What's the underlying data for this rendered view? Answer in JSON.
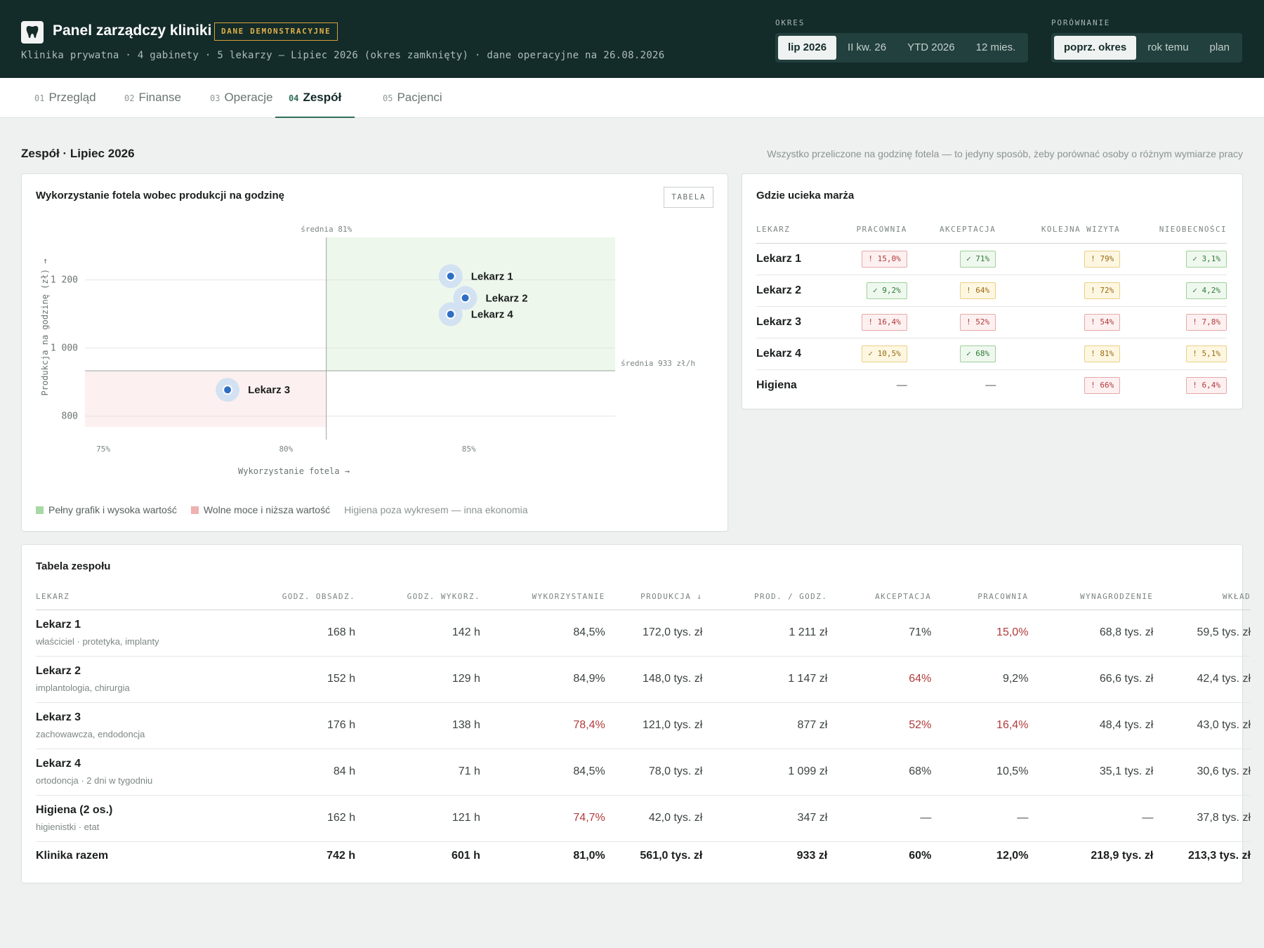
{
  "header": {
    "title": "Panel zarządczy kliniki",
    "badge": "DANE DEMONSTRACYJNE",
    "subtitle": "Klinika prywatna · 4 gabinety · 5 lekarzy — Lipiec 2026 (okres zamknięty) · dane operacyjne na 26.08.2026",
    "period_label": "OKRES",
    "period_options": [
      "lip 2026",
      "II kw. 26",
      "YTD 2026",
      "12 mies."
    ],
    "period_selected": "lip 2026",
    "compare_label": "PORÓWNANIE",
    "compare_options": [
      "poprz. okres",
      "rok temu",
      "plan"
    ],
    "compare_selected": "poprz. okres"
  },
  "tabs": [
    {
      "num": "01",
      "label": "Przegląd"
    },
    {
      "num": "02",
      "label": "Finanse"
    },
    {
      "num": "03",
      "label": "Operacje"
    },
    {
      "num": "04",
      "label": "Zespół",
      "active": true
    },
    {
      "num": "05",
      "label": "Pacjenci"
    }
  ],
  "section": {
    "title": "Zespół · Lipiec 2026",
    "note": "Wszystko przeliczone na godzinę fotela — to jedyny sposób, żeby porównać osoby o różnym wymiarze pracy"
  },
  "scatter": {
    "title": "Wykorzystanie fotela wobec produkcji na godzinę",
    "table_button": "TABELA",
    "avg_x_label": "średnia 81%",
    "avg_y_label": "średnia 933 zł/h",
    "legend_good": "Pełny grafik i wysoka wartość",
    "legend_bad": "Wolne moce i niższa wartość",
    "legend_note": "Higiena poza wykresem — inna ekonomia",
    "colors": {
      "good_zone": "#eef7ec",
      "bad_zone": "#fdf0f0",
      "point": "#2e6fc4",
      "halo": "#d3e2f2"
    }
  },
  "chart_data": {
    "type": "scatter",
    "xlabel": "Wykorzystanie fotela →",
    "ylabel": "Produkcja na godzinę (zł) →",
    "x_ticks": [
      "75%",
      "80%",
      "85%"
    ],
    "y_ticks": [
      "1 200",
      "1 000",
      "800"
    ],
    "xlim": [
      74.5,
      89
    ],
    "ylim": [
      768,
      1325
    ],
    "avg_x": 81.1,
    "avg_y": 933,
    "points": [
      {
        "label": "Lekarz 1",
        "x": 84.5,
        "y": 1211
      },
      {
        "label": "Lekarz 2",
        "x": 84.9,
        "y": 1147
      },
      {
        "label": "Lekarz 3",
        "x": 78.4,
        "y": 877
      },
      {
        "label": "Lekarz 4",
        "x": 84.5,
        "y": 1099
      }
    ]
  },
  "margin": {
    "title": "Gdzie ucieka marża",
    "columns": [
      "LEKARZ",
      "PRACOWNIA",
      "AKCEPTACJA",
      "KOLEJNA WIZYTA",
      "NIEOBECNOŚCI"
    ],
    "rows": [
      {
        "name": "Lekarz 1",
        "cells": [
          {
            "t": "! 15,0%",
            "s": "red"
          },
          {
            "t": "✓ 71%",
            "s": "green"
          },
          {
            "t": "! 79%",
            "s": "yellow"
          },
          {
            "t": "✓ 3,1%",
            "s": "green"
          }
        ]
      },
      {
        "name": "Lekarz 2",
        "cells": [
          {
            "t": "✓ 9,2%",
            "s": "green"
          },
          {
            "t": "! 64%",
            "s": "yellow"
          },
          {
            "t": "! 72%",
            "s": "yellow"
          },
          {
            "t": "✓ 4,2%",
            "s": "green"
          }
        ]
      },
      {
        "name": "Lekarz 3",
        "cells": [
          {
            "t": "! 16,4%",
            "s": "red"
          },
          {
            "t": "! 52%",
            "s": "red"
          },
          {
            "t": "! 54%",
            "s": "red"
          },
          {
            "t": "! 7,8%",
            "s": "red"
          }
        ]
      },
      {
        "name": "Lekarz 4",
        "cells": [
          {
            "t": "✓ 10,5%",
            "s": "yellow"
          },
          {
            "t": "✓ 68%",
            "s": "green"
          },
          {
            "t": "! 81%",
            "s": "yellow"
          },
          {
            "t": "! 5,1%",
            "s": "yellow"
          }
        ]
      },
      {
        "name": "Higiena",
        "cells": [
          {
            "t": "—",
            "s": "dash"
          },
          {
            "t": "—",
            "s": "dash"
          },
          {
            "t": "! 66%",
            "s": "red"
          },
          {
            "t": "! 6,4%",
            "s": "red"
          }
        ]
      }
    ]
  },
  "team": {
    "title": "Tabela zespołu",
    "columns": [
      "LEKARZ",
      "GODZ. OBSADZ.",
      "GODZ. WYKORZ.",
      "WYKORZYSTANIE",
      "PRODUKCJA ↓",
      "PROD. / GODZ.",
      "AKCEPTACJA",
      "PRACOWNIA",
      "WYNAGRODZENIE",
      "WKŁAD"
    ],
    "rows": [
      {
        "name": "Lekarz 1",
        "sub": "właściciel · protetyka, implanty",
        "cells": [
          "168 h",
          "142 h",
          "84,5%",
          "172,0 tys. zł",
          "1 211 zł",
          "71%",
          "15,0%",
          "68,8 tys. zł",
          "59,5 tys. zł"
        ],
        "neg": [
          6
        ]
      },
      {
        "name": "Lekarz 2",
        "sub": "implantologia, chirurgia",
        "cells": [
          "152 h",
          "129 h",
          "84,9%",
          "148,0 tys. zł",
          "1 147 zł",
          "64%",
          "9,2%",
          "66,6 tys. zł",
          "42,4 tys. zł"
        ],
        "neg": [
          5
        ]
      },
      {
        "name": "Lekarz 3",
        "sub": "zachowawcza, endodoncja",
        "cells": [
          "176 h",
          "138 h",
          "78,4%",
          "121,0 tys. zł",
          "877 zł",
          "52%",
          "16,4%",
          "48,4 tys. zł",
          "43,0 tys. zł"
        ],
        "neg": [
          2,
          5,
          6
        ]
      },
      {
        "name": "Lekarz 4",
        "sub": "ortodoncja · 2 dni w tygodniu",
        "cells": [
          "84 h",
          "71 h",
          "84,5%",
          "78,0 tys. zł",
          "1 099 zł",
          "68%",
          "10,5%",
          "35,1 tys. zł",
          "30,6 tys. zł"
        ],
        "neg": []
      },
      {
        "name": "Higiena (2 os.)",
        "sub": "higienistki · etat",
        "cells": [
          "162 h",
          "121 h",
          "74,7%",
          "42,0 tys. zł",
          "347 zł",
          "—",
          "—",
          "—",
          "37,8 tys. zł"
        ],
        "neg": [
          2
        ]
      }
    ],
    "total": {
      "name": "Klinika razem",
      "cells": [
        "742 h",
        "601 h",
        "81,0%",
        "561,0 tys. zł",
        "933 zł",
        "60%",
        "12,0%",
        "218,9 tys. zł",
        "213,3 tys. zł"
      ]
    }
  }
}
